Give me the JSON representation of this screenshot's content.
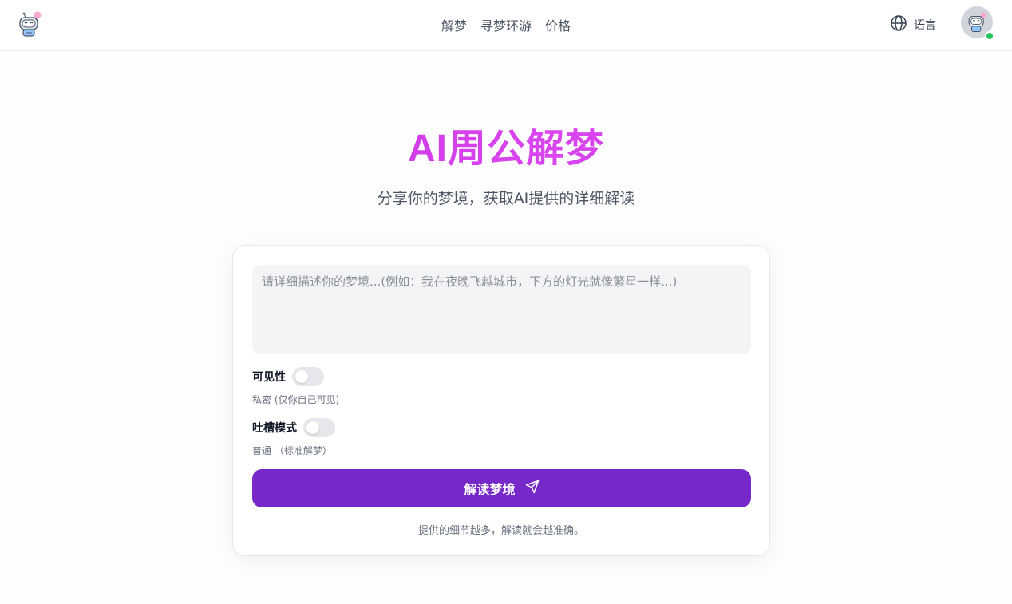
{
  "header": {
    "nav": [
      {
        "label": "解梦"
      },
      {
        "label": "寻梦环游"
      },
      {
        "label": "价格"
      }
    ],
    "language_label": "语言",
    "logo_icon": "robot-logo-icon",
    "avatar_icon": "robot-avatar-icon",
    "online_status_color": "#22c55e"
  },
  "hero": {
    "title": "AI周公解梦",
    "subtitle": "分享你的梦境，获取AI提供的详细解读"
  },
  "form": {
    "dream_input": {
      "value": "",
      "placeholder": "请详细描述你的梦境...(例如：我在夜晚飞越城市，下方的灯光就像繁星一样...)"
    },
    "visibility": {
      "label": "可见性",
      "enabled": false,
      "description": "私密 (仅你自己可见)"
    },
    "roast_mode": {
      "label": "吐槽模式",
      "enabled": false,
      "description": "普通 （标准解梦）"
    },
    "submit_label": "解读梦境",
    "submit_icon": "send-icon",
    "hint": "提供的细节越多，解读就会越准确。"
  },
  "colors": {
    "accent": "#7629c8",
    "title_gradient_start": "#c026d3",
    "title_gradient_end": "#d946ef"
  }
}
